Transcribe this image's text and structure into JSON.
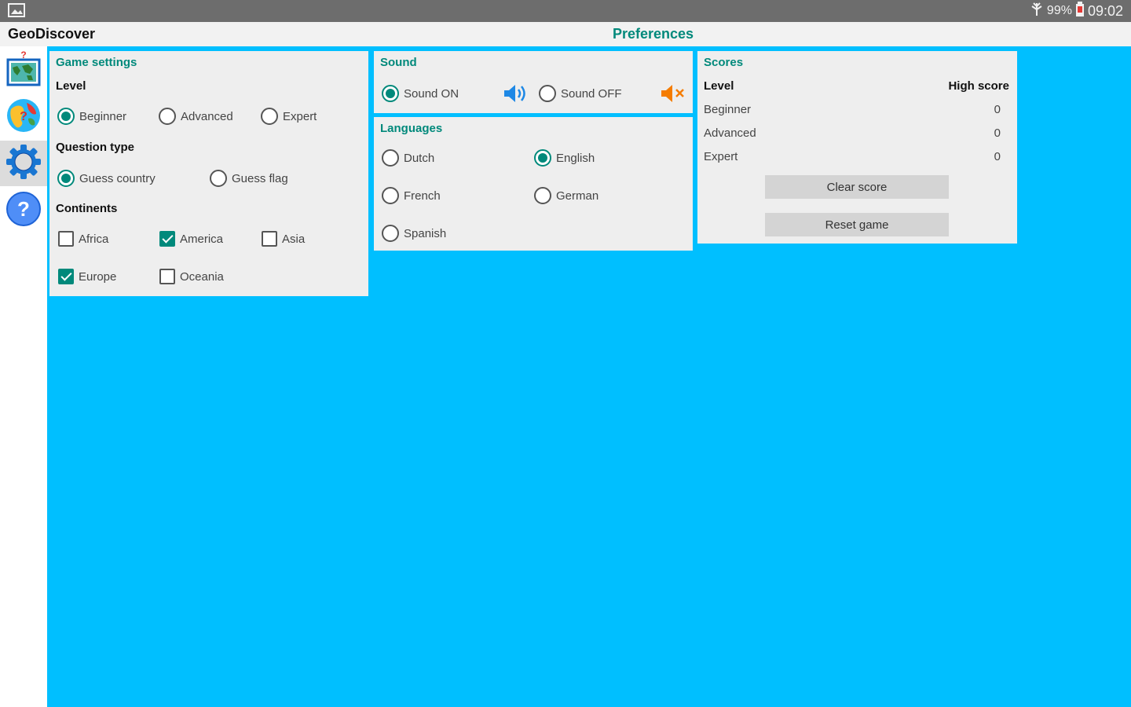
{
  "status_bar": {
    "battery": "99%",
    "time": "09:02",
    "icons": [
      "image-icon",
      "signal-icon",
      "battery-icon"
    ]
  },
  "header": {
    "app_title": "GeoDiscover",
    "page_title": "Preferences"
  },
  "sidebar": {
    "items": [
      {
        "icon": "world-map-icon",
        "active": false
      },
      {
        "icon": "globe-icon",
        "active": false
      },
      {
        "icon": "gear-icon",
        "active": true
      },
      {
        "icon": "help-icon",
        "active": false
      }
    ]
  },
  "game_settings": {
    "title": "Game settings",
    "level_label": "Level",
    "levels": {
      "beginner": "Beginner",
      "advanced": "Advanced",
      "expert": "Expert"
    },
    "level_selected": "Beginner",
    "question_type_label": "Question type",
    "question_types": {
      "guess_country": "Guess country",
      "guess_flag": "Guess flag"
    },
    "question_type_selected": "Guess country",
    "continents_label": "Continents",
    "continents": {
      "africa": {
        "label": "Africa",
        "checked": false
      },
      "america": {
        "label": "America",
        "checked": true
      },
      "asia": {
        "label": "Asia",
        "checked": false
      },
      "europe": {
        "label": "Europe",
        "checked": true
      },
      "oceania": {
        "label": "Oceania",
        "checked": false
      }
    }
  },
  "sound": {
    "title": "Sound",
    "on_label": "Sound ON",
    "off_label": "Sound OFF",
    "selected": "Sound ON"
  },
  "languages": {
    "title": "Languages",
    "dutch": "Dutch",
    "english": "English",
    "french": "French",
    "german": "German",
    "spanish": "Spanish",
    "selected": "English"
  },
  "scores": {
    "title": "Scores",
    "level_header": "Level",
    "high_score_header": "High score",
    "rows": [
      {
        "level": "Beginner",
        "score": "0"
      },
      {
        "level": "Advanced",
        "score": "0"
      },
      {
        "level": "Expert",
        "score": "0"
      }
    ],
    "clear_score_label": "Clear score",
    "reset_game_label": "Reset game"
  },
  "colors": {
    "accent": "#00897b",
    "background": "#00bfff",
    "panel": "#eeeeee",
    "status_bar": "#6d6d6d",
    "sound_on_icon": "#1e88e5",
    "sound_off_icon": "#f57c00"
  }
}
